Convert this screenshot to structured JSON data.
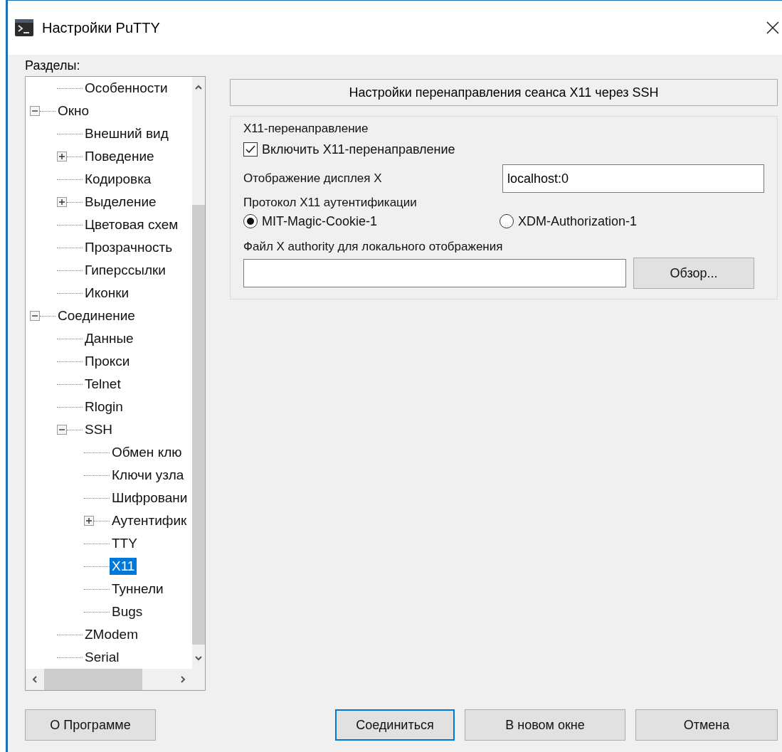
{
  "window": {
    "title": "Настройки PuTTY"
  },
  "tree": {
    "label": "Разделы:",
    "items": [
      {
        "children": [
          {
            "label": "Особенности",
            "selected": false
          }
        ]
      },
      {
        "label": "Окно",
        "expanded": true,
        "selected": false,
        "children": [
          {
            "label": "Внешний вид",
            "selected": false
          },
          {
            "label": "Поведение",
            "expanded": false,
            "selected": false
          },
          {
            "label": "Кодировка",
            "selected": false
          },
          {
            "label": "Выделение",
            "expanded": false,
            "selected": false
          },
          {
            "label": "Цветовая схем",
            "selected": false
          },
          {
            "label": "Прозрачность",
            "selected": false
          },
          {
            "label": "Гиперссылки",
            "selected": false
          },
          {
            "label": "Иконки",
            "selected": false
          }
        ]
      },
      {
        "label": "Соединение",
        "expanded": true,
        "selected": false,
        "children": [
          {
            "label": "Данные",
            "selected": false
          },
          {
            "label": "Прокси",
            "selected": false
          },
          {
            "label": "Telnet",
            "selected": false
          },
          {
            "label": "Rlogin",
            "selected": false
          },
          {
            "label": "SSH",
            "expanded": true,
            "selected": false,
            "children": [
              {
                "label": "Обмен клю",
                "selected": false
              },
              {
                "label": "Ключи узла",
                "selected": false
              },
              {
                "label": "Шифровани",
                "selected": false
              },
              {
                "label": "Аутентифик",
                "expanded": false,
                "selected": false
              },
              {
                "label": "TTY",
                "selected": false
              },
              {
                "label": "X11",
                "selected": true
              },
              {
                "label": "Туннели",
                "selected": false
              },
              {
                "label": "Bugs",
                "selected": false
              }
            ]
          },
          {
            "label": "ZModem",
            "selected": false
          },
          {
            "label": "Serial",
            "selected": false
          }
        ]
      }
    ]
  },
  "panel": {
    "header": "Настройки перенаправления сеанса X11 через SSH",
    "group": {
      "legend": "X11-перенаправление",
      "enable": {
        "label": "Включить X11-перенаправление",
        "checked": true
      },
      "display": {
        "label": "Отображение дисплея X",
        "value": "localhost:0"
      },
      "protocol": {
        "label": "Протокол X11 аутентификации",
        "options": [
          {
            "label": "MIT-Magic-Cookie-1",
            "selected": true
          },
          {
            "label": "XDM-Authorization-1",
            "selected": false
          }
        ]
      },
      "authority": {
        "label": "Файл X authority для локального отображения",
        "browse": "Обзор..."
      }
    }
  },
  "about_button": "О Программе",
  "buttons": [
    {
      "label": "Соединиться",
      "default": true
    },
    {
      "label": "В новом окне",
      "default": false
    },
    {
      "label": "Отмена",
      "default": false
    }
  ]
}
